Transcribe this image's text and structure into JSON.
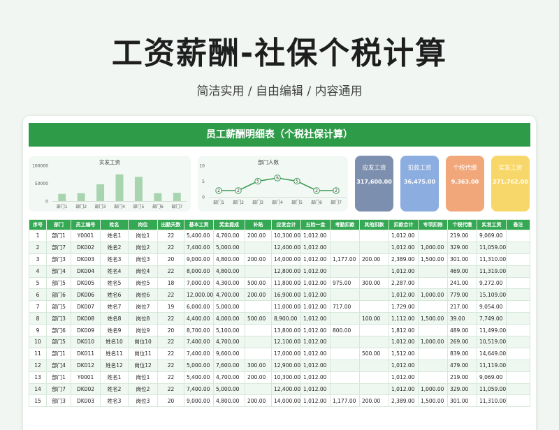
{
  "page": {
    "title": "工资薪酬-社保个税计算",
    "subtitle": "简洁实用 / 自由编辑 / 内容通用"
  },
  "sheet": {
    "title": "员工薪酬明细表（个税社保计算）"
  },
  "charts": [
    {
      "type": "bar",
      "title": "实发工资",
      "yticks": [
        "100000",
        "50000",
        "0"
      ],
      "ylim": [
        0,
        100000
      ],
      "categories": [
        "部门1",
        "部门2",
        "部门3",
        "部门4",
        "部门5",
        "部门6",
        "部门7"
      ],
      "values": [
        20000,
        22000,
        47000,
        75000,
        68000,
        22000,
        23000
      ],
      "bar_color": "#a8d5b0"
    },
    {
      "type": "line",
      "title": "部门人数",
      "yticks": [
        "10",
        "5",
        "0"
      ],
      "ylim": [
        0,
        10
      ],
      "categories": [
        "部门1",
        "部门2",
        "部门3",
        "部门4",
        "部门5",
        "部门6",
        "部门7"
      ],
      "values": [
        2,
        2,
        5,
        6,
        5,
        2,
        2
      ],
      "line_color": "#3a9a53"
    }
  ],
  "kpis": [
    {
      "label": "应发工资",
      "value": "317,600.00",
      "color": "#7d8fae"
    },
    {
      "label": "扣款工资",
      "value": "36,475.00",
      "color": "#8cade0"
    },
    {
      "label": "个税代缴",
      "value": "9,363.00",
      "color": "#f1a77a"
    },
    {
      "label": "实发工资",
      "value": "271,762.00",
      "color": "#f8d76a"
    }
  ],
  "columns": [
    "序号",
    "部门",
    "员工编号",
    "姓名",
    "岗位",
    "出勤天数",
    "基本工资",
    "奖金提成",
    "补贴",
    "应发合计",
    "五险一金",
    "考勤扣款",
    "其他扣款",
    "扣款合计",
    "专项扣除",
    "个税代缴",
    "实发工资",
    "备注"
  ],
  "rows": [
    [
      "1",
      "部门1",
      "Y0001",
      "姓名1",
      "岗位1",
      "22",
      "5,400.00",
      "4,700.00",
      "200.00",
      "10,300.00",
      "1,012.00",
      "",
      "",
      "1,012.00",
      "",
      "219.00",
      "9,069.00",
      ""
    ],
    [
      "2",
      "部门7",
      "DK002",
      "姓名2",
      "岗位2",
      "22",
      "7,400.00",
      "5,000.00",
      "",
      "12,400.00",
      "1,012.00",
      "",
      "",
      "1,012.00",
      "1,000.00",
      "329.00",
      "11,059.00",
      ""
    ],
    [
      "3",
      "部门3",
      "DK003",
      "姓名3",
      "岗位3",
      "20",
      "9,000.00",
      "4,800.00",
      "200.00",
      "14,000.00",
      "1,012.00",
      "1,177.00",
      "200.00",
      "2,389.00",
      "1,500.00",
      "301.00",
      "11,310.00",
      ""
    ],
    [
      "4",
      "部门4",
      "DK004",
      "姓名4",
      "岗位4",
      "22",
      "8,000.00",
      "4,800.00",
      "",
      "12,800.00",
      "1,012.00",
      "",
      "",
      "1,012.00",
      "",
      "469.00",
      "11,319.00",
      ""
    ],
    [
      "5",
      "部门5",
      "DK005",
      "姓名5",
      "岗位5",
      "18",
      "7,000.00",
      "4,300.00",
      "500.00",
      "11,800.00",
      "1,012.00",
      "975.00",
      "300.00",
      "2,287.00",
      "",
      "241.00",
      "9,272.00",
      ""
    ],
    [
      "6",
      "部门6",
      "DK006",
      "姓名6",
      "岗位6",
      "22",
      "12,000.00",
      "4,700.00",
      "200.00",
      "16,900.00",
      "1,012.00",
      "",
      "",
      "1,012.00",
      "1,000.00",
      "779.00",
      "15,109.00",
      ""
    ],
    [
      "7",
      "部门5",
      "DK007",
      "姓名7",
      "岗位7",
      "19",
      "6,000.00",
      "5,000.00",
      "",
      "11,000.00",
      "1,012.00",
      "717.00",
      "",
      "1,729.00",
      "",
      "217.00",
      "9,054.00",
      ""
    ],
    [
      "8",
      "部门3",
      "DK008",
      "姓名8",
      "岗位8",
      "22",
      "4,400.00",
      "4,000.00",
      "500.00",
      "8,900.00",
      "1,012.00",
      "",
      "100.00",
      "1,112.00",
      "1,500.00",
      "39.00",
      "7,749.00",
      ""
    ],
    [
      "9",
      "部门6",
      "DK009",
      "姓名9",
      "岗位9",
      "20",
      "8,700.00",
      "5,100.00",
      "",
      "13,800.00",
      "1,012.00",
      "800.00",
      "",
      "1,812.00",
      "",
      "489.00",
      "11,499.00",
      ""
    ],
    [
      "10",
      "部门5",
      "DK010",
      "姓名10",
      "岗位10",
      "22",
      "7,400.00",
      "4,700.00",
      "",
      "12,100.00",
      "1,012.00",
      "",
      "",
      "1,012.00",
      "1,000.00",
      "269.00",
      "10,519.00",
      ""
    ],
    [
      "11",
      "部门1",
      "DK011",
      "姓名11",
      "岗位11",
      "22",
      "7,400.00",
      "9,600.00",
      "",
      "17,000.00",
      "1,012.00",
      "",
      "500.00",
      "1,512.00",
      "",
      "839.00",
      "14,649.00",
      ""
    ],
    [
      "12",
      "部门4",
      "DK012",
      "姓名12",
      "岗位12",
      "22",
      "5,000.00",
      "7,600.00",
      "300.00",
      "12,900.00",
      "1,012.00",
      "",
      "",
      "1,012.00",
      "",
      "479.00",
      "11,119.00",
      ""
    ],
    [
      "13",
      "部门1",
      "Y0001",
      "姓名1",
      "岗位1",
      "22",
      "5,400.00",
      "4,700.00",
      "200.00",
      "10,300.00",
      "1,012.00",
      "",
      "",
      "1,012.00",
      "",
      "219.00",
      "9,069.00",
      ""
    ],
    [
      "14",
      "部门7",
      "DK002",
      "姓名2",
      "岗位2",
      "22",
      "7,400.00",
      "5,000.00",
      "",
      "12,400.00",
      "1,012.00",
      "",
      "",
      "1,012.00",
      "1,000.00",
      "329.00",
      "11,059.00",
      ""
    ],
    [
      "15",
      "部门3",
      "DK003",
      "姓名3",
      "岗位3",
      "20",
      "9,000.00",
      "4,800.00",
      "200.00",
      "14,000.00",
      "1,012.00",
      "1,177.00",
      "200.00",
      "2,389.00",
      "1,500.00",
      "301.00",
      "11,310.00",
      ""
    ]
  ]
}
